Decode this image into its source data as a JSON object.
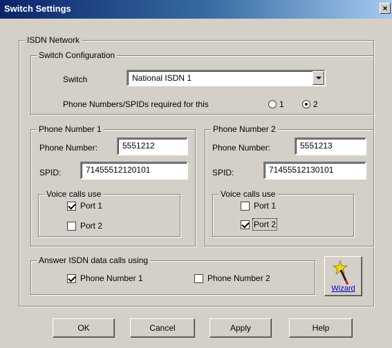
{
  "window": {
    "title": "Switch Settings",
    "close_glyph": "×"
  },
  "isdn_network": {
    "legend": "ISDN Network",
    "switch_config": {
      "legend": "Switch Configuration",
      "switch_label": "Switch",
      "switch_value": "National ISDN 1",
      "numbers_label": "Phone Numbers/SPIDs required for this",
      "radio_options": [
        "1",
        "2"
      ],
      "radio_selected": "2"
    },
    "phone1": {
      "legend": "Phone Number 1",
      "phone_label": "Phone Number:",
      "phone_value": "5551212",
      "spid_label": "SPID:",
      "spid_value": "71455512120101",
      "voice": {
        "legend": "Voice calls use",
        "port1_label": "Port 1",
        "port1_checked": true,
        "port2_label": "Port 2",
        "port2_checked": false
      }
    },
    "phone2": {
      "legend": "Phone Number 2",
      "phone_label": "Phone Number:",
      "phone_value": "5551213",
      "spid_label": "SPID:",
      "spid_value": "71455512130101",
      "voice": {
        "legend": "Voice calls use",
        "port1_label": "Port 1",
        "port1_checked": false,
        "port2_label": "Port 2",
        "port2_checked": true
      }
    },
    "answer": {
      "legend": "Answer ISDN data calls using",
      "option1_label": "Phone Number 1",
      "option1_checked": true,
      "option2_label": "Phone Number 2",
      "option2_checked": false
    },
    "wizard_label": "Wizard"
  },
  "buttons": {
    "ok": "OK",
    "cancel": "Cancel",
    "apply": "Apply",
    "help": "Help"
  },
  "colors": {
    "face": "#d4d0c8",
    "title_start": "#0a246a",
    "title_end": "#a6caf0",
    "link": "#0000cc"
  }
}
